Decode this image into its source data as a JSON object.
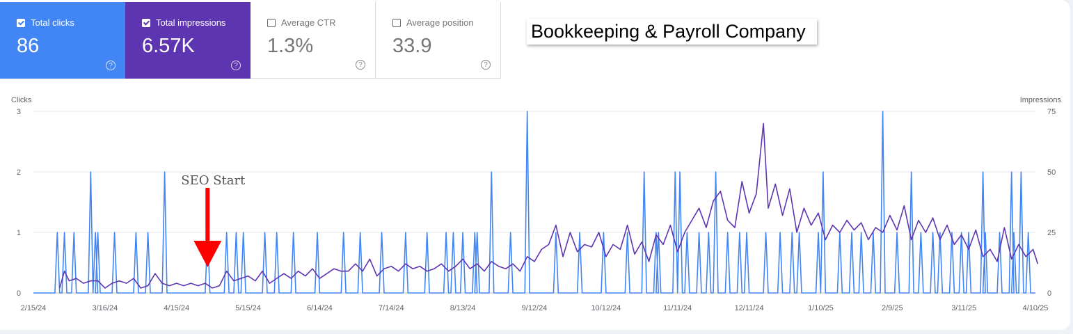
{
  "metrics": {
    "clicks": {
      "label": "Total clicks",
      "value": "86",
      "checked": true
    },
    "impressions": {
      "label": "Total impressions",
      "value": "6.57K",
      "checked": true
    },
    "ctr": {
      "label": "Average CTR",
      "value": "1.3%",
      "checked": false
    },
    "position": {
      "label": "Average position",
      "value": "33.9",
      "checked": false
    }
  },
  "help_glyph": "?",
  "company_label": "Bookkeeping & Payroll Company",
  "annotation": {
    "text": "SEO Start",
    "date": "4/28/24",
    "arrow_color": "#ff0000"
  },
  "colors": {
    "clicks": "#4285f4",
    "impressions": "#5e35b1"
  },
  "chart_data": {
    "type": "line",
    "title": "",
    "y_left_label": "Clicks",
    "y_right_label": "Impressions",
    "y_left_ticks": [
      "0",
      "1",
      "2",
      "3"
    ],
    "y_right_ticks": [
      "0",
      "25",
      "50",
      "75"
    ],
    "y_left_range": [
      0,
      3
    ],
    "y_right_range": [
      0,
      75
    ],
    "x_ticks": [
      "2/15/24",
      "3/16/24",
      "4/15/24",
      "5/15/24",
      "6/14/24",
      "7/14/24",
      "8/13/24",
      "9/12/24",
      "10/12/24",
      "11/11/24",
      "12/11/24",
      "1/10/25",
      "2/9/25",
      "3/11/25",
      "4/10/25"
    ],
    "x_range": [
      "2/15/24",
      "4/10/25"
    ],
    "grid": true,
    "series": [
      {
        "name": "Clicks",
        "axis": "left",
        "points": [
          [
            "2/25/24",
            1
          ],
          [
            "2/28/24",
            1
          ],
          [
            "3/3/24",
            1
          ],
          [
            "3/10/24",
            2
          ],
          [
            "3/12/24",
            1
          ],
          [
            "3/13/24",
            1
          ],
          [
            "3/20/24",
            1
          ],
          [
            "3/29/24",
            1
          ],
          [
            "4/3/24",
            1
          ],
          [
            "4/10/24",
            2
          ],
          [
            "4/28/24",
            1
          ],
          [
            "5/6/24",
            1
          ],
          [
            "5/10/24",
            1
          ],
          [
            "5/13/24",
            1
          ],
          [
            "5/22/24",
            1
          ],
          [
            "5/27/24",
            1
          ],
          [
            "6/3/24",
            1
          ],
          [
            "6/13/24",
            1
          ],
          [
            "6/24/24",
            1
          ],
          [
            "7/1/24",
            1
          ],
          [
            "7/10/24",
            1
          ],
          [
            "7/20/24",
            1
          ],
          [
            "7/29/24",
            1
          ],
          [
            "8/6/24",
            1
          ],
          [
            "8/9/24",
            1
          ],
          [
            "8/13/24",
            1
          ],
          [
            "8/18/24",
            1
          ],
          [
            "8/19/24",
            1
          ],
          [
            "8/25/24",
            2
          ],
          [
            "9/2/24",
            1
          ],
          [
            "9/9/24",
            3
          ],
          [
            "9/21/24",
            1
          ],
          [
            "10/1/24",
            1
          ],
          [
            "10/11/24",
            1
          ],
          [
            "10/21/24",
            1
          ],
          [
            "10/28/24",
            2
          ],
          [
            "11/2/24",
            1
          ],
          [
            "11/3/24",
            1
          ],
          [
            "11/10/24",
            2
          ],
          [
            "11/12/24",
            2
          ],
          [
            "11/15/24",
            1
          ],
          [
            "11/20/24",
            1
          ],
          [
            "11/24/24",
            1
          ],
          [
            "11/27/24",
            2
          ],
          [
            "12/2/24",
            1
          ],
          [
            "12/7/24",
            1
          ],
          [
            "12/10/24",
            1
          ],
          [
            "12/18/24",
            1
          ],
          [
            "12/24/24",
            1
          ],
          [
            "12/29/24",
            1
          ],
          [
            "1/1/25",
            1
          ],
          [
            "1/9/25",
            1
          ],
          [
            "1/11/25",
            2
          ],
          [
            "1/18/25",
            1
          ],
          [
            "1/23/25",
            1
          ],
          [
            "1/27/25",
            1
          ],
          [
            "2/1/25",
            1
          ],
          [
            "2/5/25",
            3
          ],
          [
            "2/11/25",
            1
          ],
          [
            "2/17/25",
            2
          ],
          [
            "2/21/25",
            1
          ],
          [
            "2/26/25",
            1
          ],
          [
            "3/1/25",
            1
          ],
          [
            "3/6/25",
            1
          ],
          [
            "3/10/25",
            1
          ],
          [
            "3/13/25",
            1
          ],
          [
            "3/19/25",
            2
          ],
          [
            "3/20/25",
            1
          ],
          [
            "3/26/25",
            1
          ],
          [
            "3/31/25",
            2
          ],
          [
            "4/1/25",
            1
          ],
          [
            "4/4/25",
            2
          ],
          [
            "4/7/25",
            1
          ]
        ]
      },
      {
        "name": "Impressions",
        "axis": "right",
        "points": [
          [
            "2/26/24",
            2
          ],
          [
            "2/28/24",
            9
          ],
          [
            "3/1/24",
            5
          ],
          [
            "3/4/24",
            6
          ],
          [
            "3/7/24",
            4
          ],
          [
            "3/10/24",
            5
          ],
          [
            "3/13/24",
            5
          ],
          [
            "3/16/24",
            2
          ],
          [
            "3/19/24",
            4
          ],
          [
            "3/22/24",
            5
          ],
          [
            "3/25/24",
            4
          ],
          [
            "3/28/24",
            6
          ],
          [
            "3/31/24",
            2
          ],
          [
            "4/3/24",
            3
          ],
          [
            "4/6/24",
            8
          ],
          [
            "4/9/24",
            4
          ],
          [
            "4/12/24",
            3
          ],
          [
            "4/15/24",
            4
          ],
          [
            "4/18/24",
            3
          ],
          [
            "4/21/24",
            4
          ],
          [
            "4/24/24",
            3
          ],
          [
            "4/27/24",
            4
          ],
          [
            "4/30/24",
            2
          ],
          [
            "5/3/24",
            3
          ],
          [
            "5/6/24",
            9
          ],
          [
            "5/9/24",
            5
          ],
          [
            "5/12/24",
            6
          ],
          [
            "5/15/24",
            7
          ],
          [
            "5/18/24",
            5
          ],
          [
            "5/21/24",
            9
          ],
          [
            "5/24/24",
            4
          ],
          [
            "5/27/24",
            6
          ],
          [
            "5/30/24",
            8
          ],
          [
            "6/2/24",
            6
          ],
          [
            "6/5/24",
            9
          ],
          [
            "6/8/24",
            7
          ],
          [
            "6/11/24",
            10
          ],
          [
            "6/14/24",
            6
          ],
          [
            "6/17/24",
            8
          ],
          [
            "6/20/24",
            10
          ],
          [
            "6/23/24",
            9
          ],
          [
            "6/26/24",
            9
          ],
          [
            "6/29/24",
            12
          ],
          [
            "7/2/24",
            9
          ],
          [
            "7/5/24",
            14
          ],
          [
            "7/8/24",
            7
          ],
          [
            "7/11/24",
            10
          ],
          [
            "7/14/24",
            11
          ],
          [
            "7/17/24",
            9
          ],
          [
            "7/20/24",
            12
          ],
          [
            "7/23/24",
            10
          ],
          [
            "7/26/24",
            11
          ],
          [
            "7/29/24",
            9
          ],
          [
            "8/1/24",
            10
          ],
          [
            "8/4/24",
            12
          ],
          [
            "8/7/24",
            9
          ],
          [
            "8/10/24",
            11
          ],
          [
            "8/13/24",
            14
          ],
          [
            "8/16/24",
            10
          ],
          [
            "8/19/24",
            12
          ],
          [
            "8/22/24",
            9
          ],
          [
            "8/25/24",
            13
          ],
          [
            "8/28/24",
            11
          ],
          [
            "8/31/24",
            10
          ],
          [
            "9/3/24",
            12
          ],
          [
            "9/6/24",
            9
          ],
          [
            "9/9/24",
            15
          ],
          [
            "9/12/24",
            13
          ],
          [
            "9/15/24",
            18
          ],
          [
            "9/18/24",
            20
          ],
          [
            "9/21/24",
            28
          ],
          [
            "9/24/24",
            15
          ],
          [
            "9/27/24",
            25
          ],
          [
            "9/30/24",
            17
          ],
          [
            "10/3/24",
            20
          ],
          [
            "10/6/24",
            19
          ],
          [
            "10/9/24",
            25
          ],
          [
            "10/12/24",
            15
          ],
          [
            "10/15/24",
            20
          ],
          [
            "10/18/24",
            18
          ],
          [
            "10/21/24",
            28
          ],
          [
            "10/24/24",
            16
          ],
          [
            "10/27/24",
            21
          ],
          [
            "10/30/24",
            13
          ],
          [
            "11/2/24",
            24
          ],
          [
            "11/5/24",
            20
          ],
          [
            "11/8/24",
            28
          ],
          [
            "11/11/24",
            17
          ],
          [
            "11/14/24",
            25
          ],
          [
            "11/17/24",
            30
          ],
          [
            "11/20/24",
            35
          ],
          [
            "11/23/24",
            27
          ],
          [
            "11/26/24",
            38
          ],
          [
            "11/29/24",
            42
          ],
          [
            "12/2/24",
            30
          ],
          [
            "12/5/24",
            27
          ],
          [
            "12/8/24",
            46
          ],
          [
            "12/11/24",
            33
          ],
          [
            "12/14/24",
            41
          ],
          [
            "12/17/24",
            70
          ],
          [
            "12/19/24",
            35
          ],
          [
            "12/22/24",
            45
          ],
          [
            "12/25/24",
            32
          ],
          [
            "12/28/24",
            43
          ],
          [
            "12/31/24",
            25
          ],
          [
            "1/3/25",
            35
          ],
          [
            "1/6/25",
            28
          ],
          [
            "1/9/25",
            33
          ],
          [
            "1/12/25",
            22
          ],
          [
            "1/15/25",
            28
          ],
          [
            "1/18/25",
            25
          ],
          [
            "1/21/25",
            30
          ],
          [
            "1/24/25",
            26
          ],
          [
            "1/27/25",
            29
          ],
          [
            "1/30/25",
            22
          ],
          [
            "2/2/25",
            27
          ],
          [
            "2/5/25",
            25
          ],
          [
            "2/8/25",
            32
          ],
          [
            "2/11/25",
            26
          ],
          [
            "2/14/25",
            36
          ],
          [
            "2/17/25",
            22
          ],
          [
            "2/20/25",
            30
          ],
          [
            "2/23/25",
            25
          ],
          [
            "2/26/25",
            31
          ],
          [
            "3/1/25",
            22
          ],
          [
            "3/4/25",
            28
          ],
          [
            "3/7/25",
            20
          ],
          [
            "3/10/25",
            24
          ],
          [
            "3/13/25",
            18
          ],
          [
            "3/16/25",
            26
          ],
          [
            "3/19/25",
            15
          ],
          [
            "3/22/25",
            18
          ],
          [
            "3/25/25",
            13
          ],
          [
            "3/28/25",
            27
          ],
          [
            "3/31/25",
            14
          ],
          [
            "4/3/25",
            20
          ],
          [
            "4/6/25",
            15
          ],
          [
            "4/9/25",
            18
          ],
          [
            "4/11/25",
            12
          ]
        ]
      }
    ]
  }
}
